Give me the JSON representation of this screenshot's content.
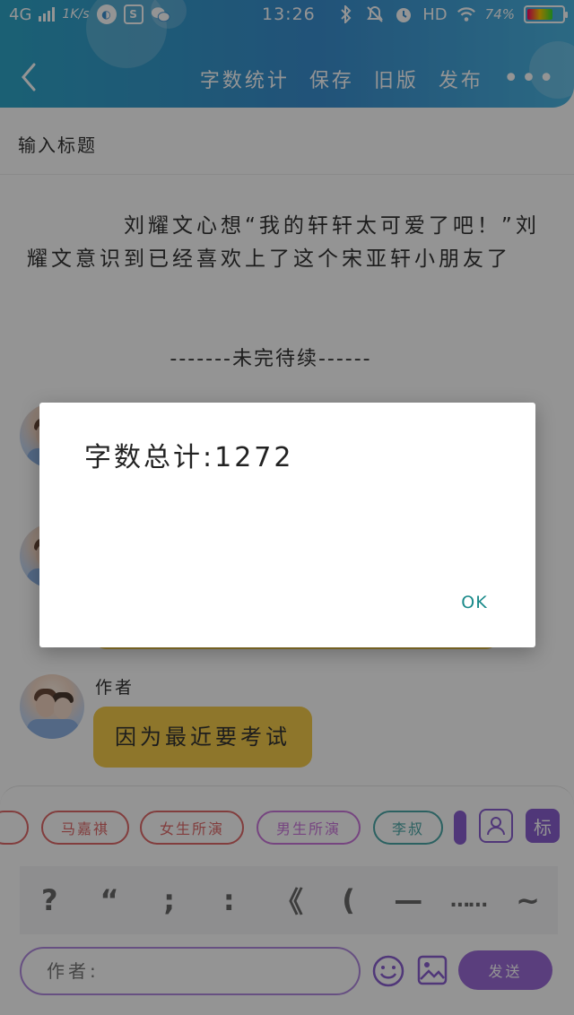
{
  "status_bar": {
    "network": "4G",
    "speed": "1K/s",
    "time": "13:26",
    "hd": "HD",
    "battery": "74%",
    "battery_level": 0.74
  },
  "header": {
    "actions": [
      "字数统计",
      "保存",
      "旧版",
      "发布"
    ],
    "more": "•••"
  },
  "editor": {
    "title_placeholder": "输入标题",
    "body": "刘耀文心想“我的轩轩太可爱了吧！”刘耀文意识到已经喜欢上了这个宋亚轩小朋友了",
    "to_be_continued": "-------未完待续------"
  },
  "chat": {
    "author_name": "作者",
    "last_message": "因为最近要考试"
  },
  "chips": [
    {
      "label": "马嘉祺",
      "color": "#e06a6a"
    },
    {
      "label": "女生所演",
      "color": "#e06a6a"
    },
    {
      "label": "男生所演",
      "color": "#cc77dd"
    },
    {
      "label": "李叔",
      "color": "#4aa8a8"
    }
  ],
  "punctuation": [
    "?",
    "“",
    ";",
    ":",
    "《",
    "(",
    "—",
    "……",
    "~"
  ],
  "input": {
    "placeholder": "作者:",
    "send_label": "发送"
  },
  "side_button_label": "标",
  "dialog": {
    "message": "字数总计:1272",
    "ok_label": "OK"
  }
}
